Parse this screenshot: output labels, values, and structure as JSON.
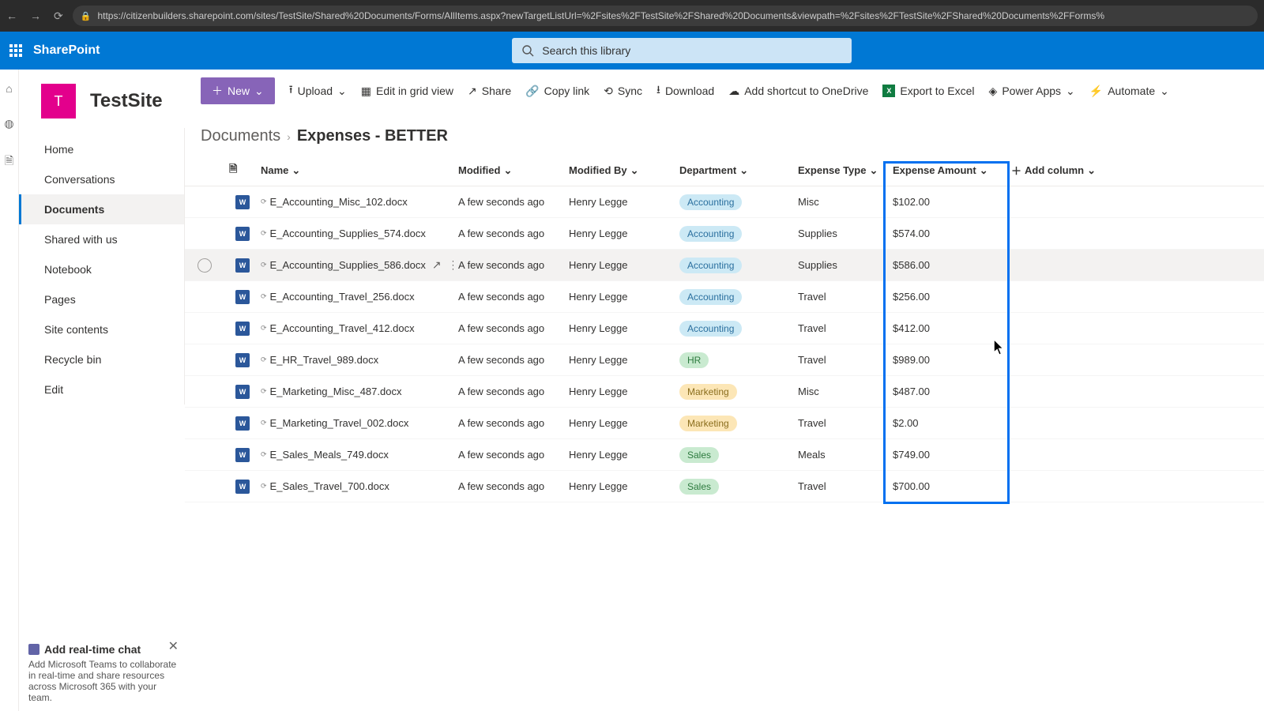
{
  "browser": {
    "url": "https://citizenbuilders.sharepoint.com/sites/TestSite/Shared%20Documents/Forms/AllItems.aspx?newTargetListUrl=%2Fsites%2FTestSite%2FShared%20Documents&viewpath=%2Fsites%2FTestSite%2FShared%20Documents%2FForms%"
  },
  "suite": {
    "brand": "SharePoint",
    "search_placeholder": "Search this library"
  },
  "site": {
    "logo_letter": "T",
    "title": "TestSite"
  },
  "left_nav": {
    "items": [
      "Home",
      "Conversations",
      "Documents",
      "Shared with us",
      "Notebook",
      "Pages",
      "Site contents",
      "Recycle bin",
      "Edit"
    ],
    "active_index": 2
  },
  "promo": {
    "title": "Add real-time chat",
    "body": "Add Microsoft Teams to collaborate in real-time and share resources across Microsoft 365 with your team."
  },
  "cmd": {
    "new": "New",
    "upload": "Upload",
    "edit_grid": "Edit in grid view",
    "share": "Share",
    "copy_link": "Copy link",
    "sync": "Sync",
    "download": "Download",
    "shortcut": "Add shortcut to OneDrive",
    "excel": "Export to Excel",
    "powerapps": "Power Apps",
    "automate": "Automate"
  },
  "breadcrumb": {
    "parent": "Documents",
    "current": "Expenses - BETTER"
  },
  "table": {
    "columns": [
      "Name",
      "Modified",
      "Modified By",
      "Department",
      "Expense Type",
      "Expense Amount"
    ],
    "add_column": "Add column",
    "hover_index": 2,
    "rows": [
      {
        "name": "E_Accounting_Misc_102.docx",
        "modified": "A few seconds ago",
        "by": "Henry Legge",
        "dept": "Accounting",
        "type": "Misc",
        "amount": "$102.00"
      },
      {
        "name": "E_Accounting_Supplies_574.docx",
        "modified": "A few seconds ago",
        "by": "Henry Legge",
        "dept": "Accounting",
        "type": "Supplies",
        "amount": "$574.00"
      },
      {
        "name": "E_Accounting_Supplies_586.docx",
        "modified": "A few seconds ago",
        "by": "Henry Legge",
        "dept": "Accounting",
        "type": "Supplies",
        "amount": "$586.00"
      },
      {
        "name": "E_Accounting_Travel_256.docx",
        "modified": "A few seconds ago",
        "by": "Henry Legge",
        "dept": "Accounting",
        "type": "Travel",
        "amount": "$256.00"
      },
      {
        "name": "E_Accounting_Travel_412.docx",
        "modified": "A few seconds ago",
        "by": "Henry Legge",
        "dept": "Accounting",
        "type": "Travel",
        "amount": "$412.00"
      },
      {
        "name": "E_HR_Travel_989.docx",
        "modified": "A few seconds ago",
        "by": "Henry Legge",
        "dept": "HR",
        "type": "Travel",
        "amount": "$989.00"
      },
      {
        "name": "E_Marketing_Misc_487.docx",
        "modified": "A few seconds ago",
        "by": "Henry Legge",
        "dept": "Marketing",
        "type": "Misc",
        "amount": "$487.00"
      },
      {
        "name": "E_Marketing_Travel_002.docx",
        "modified": "A few seconds ago",
        "by": "Henry Legge",
        "dept": "Marketing",
        "type": "Travel",
        "amount": "$2.00"
      },
      {
        "name": "E_Sales_Meals_749.docx",
        "modified": "A few seconds ago",
        "by": "Henry Legge",
        "dept": "Sales",
        "type": "Meals",
        "amount": "$749.00"
      },
      {
        "name": "E_Sales_Travel_700.docx",
        "modified": "A few seconds ago",
        "by": "Henry Legge",
        "dept": "Sales",
        "type": "Travel",
        "amount": "$700.00"
      }
    ]
  }
}
